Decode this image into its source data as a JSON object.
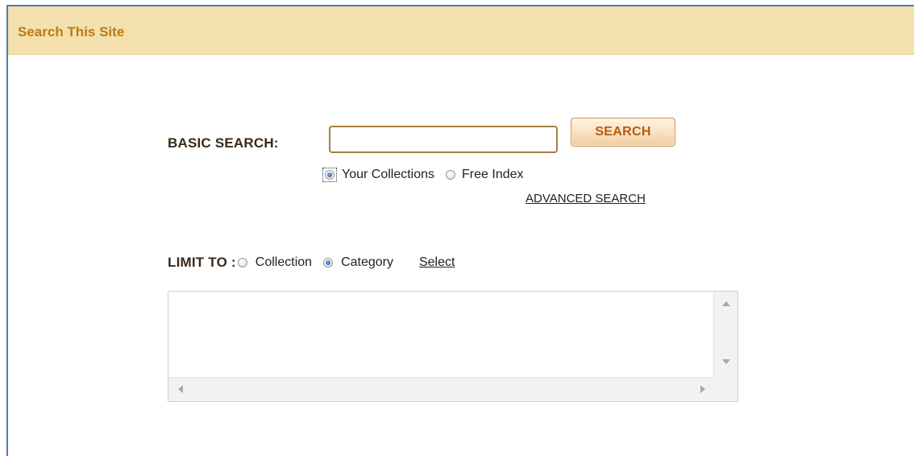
{
  "panel": {
    "title": "Search This Site"
  },
  "basic_search": {
    "label": "BASIC SEARCH:",
    "input_value": "",
    "button_label": "SEARCH",
    "scope_options": [
      {
        "label": "Your Collections",
        "checked": true
      },
      {
        "label": "Free Index",
        "checked": false
      }
    ],
    "advanced_link": "ADVANCED SEARCH"
  },
  "limit_to": {
    "label": "LIMIT TO :",
    "options": [
      {
        "label": "Collection",
        "checked": false
      },
      {
        "label": "Category",
        "checked": true
      }
    ],
    "select_link": "Select",
    "list_items": []
  },
  "colors": {
    "header_bg": "#f3e0ac",
    "title_color": "#bd7a16",
    "panel_border": "#4b7db6",
    "button_text": "#b85b12"
  }
}
